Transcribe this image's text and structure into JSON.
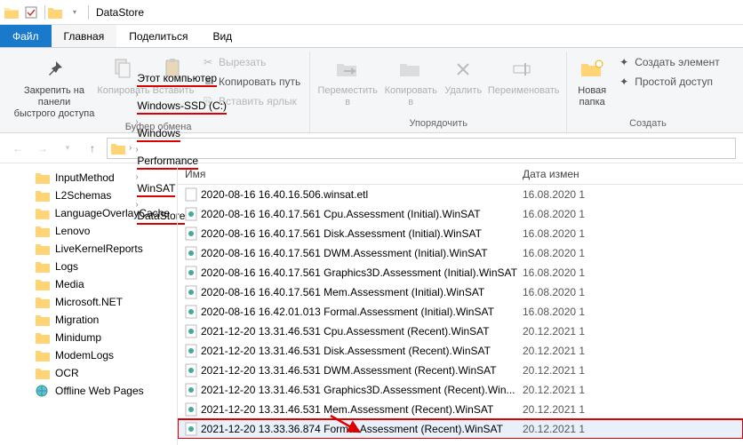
{
  "window": {
    "title": "DataStore"
  },
  "menu": {
    "file": "Файл",
    "home": "Главная",
    "share": "Поделиться",
    "view": "Вид"
  },
  "ribbon": {
    "pin": "Закрепить на панели\nбыстрого доступа",
    "copy": "Копировать",
    "paste": "Вставить",
    "cut": "Вырезать",
    "copypath": "Копировать путь",
    "pastelink": "Вставить ярлык",
    "group_clip": "Буфер обмена",
    "moveto": "Переместить\nв",
    "copyto": "Копировать\nв",
    "delete": "Удалить",
    "rename": "Переименовать",
    "group_org": "Упорядочить",
    "newfolder": "Новая\nпапка",
    "newitem": "Создать элемент",
    "easyaccess": "Простой доступ",
    "group_new": "Создать"
  },
  "breadcrumb": [
    "Этот компьютер",
    "Windows-SSD (C:)",
    "Windows",
    "Performance",
    "WinSAT",
    "DataStore"
  ],
  "columns": {
    "name": "Имя",
    "date": "Дата измен"
  },
  "tree": [
    {
      "label": "InputMethod",
      "icon": "folder"
    },
    {
      "label": "L2Schemas",
      "icon": "folder"
    },
    {
      "label": "LanguageOverlayCache",
      "icon": "folder"
    },
    {
      "label": "Lenovo",
      "icon": "folder"
    },
    {
      "label": "LiveKernelReports",
      "icon": "folder"
    },
    {
      "label": "Logs",
      "icon": "folder"
    },
    {
      "label": "Media",
      "icon": "folder"
    },
    {
      "label": "Microsoft.NET",
      "icon": "folder"
    },
    {
      "label": "Migration",
      "icon": "folder"
    },
    {
      "label": "Minidump",
      "icon": "folder"
    },
    {
      "label": "ModemLogs",
      "icon": "folder"
    },
    {
      "label": "OCR",
      "icon": "folder"
    },
    {
      "label": "Offline Web Pages",
      "icon": "web"
    }
  ],
  "files": [
    {
      "name": "2020-08-16 16.40.16.506.winsat.etl",
      "date": "16.08.2020 1",
      "icon": "etl"
    },
    {
      "name": "2020-08-16 16.40.17.561 Cpu.Assessment (Initial).WinSAT",
      "date": "16.08.2020 1",
      "icon": "winsat"
    },
    {
      "name": "2020-08-16 16.40.17.561 Disk.Assessment (Initial).WinSAT",
      "date": "16.08.2020 1",
      "icon": "winsat"
    },
    {
      "name": "2020-08-16 16.40.17.561 DWM.Assessment (Initial).WinSAT",
      "date": "16.08.2020 1",
      "icon": "winsat"
    },
    {
      "name": "2020-08-16 16.40.17.561 Graphics3D.Assessment (Initial).WinSAT",
      "date": "16.08.2020 1",
      "icon": "winsat"
    },
    {
      "name": "2020-08-16 16.40.17.561 Mem.Assessment (Initial).WinSAT",
      "date": "16.08.2020 1",
      "icon": "winsat"
    },
    {
      "name": "2020-08-16 16.42.01.013 Formal.Assessment (Initial).WinSAT",
      "date": "16.08.2020 1",
      "icon": "winsat"
    },
    {
      "name": "2021-12-20 13.31.46.531 Cpu.Assessment (Recent).WinSAT",
      "date": "20.12.2021 1",
      "icon": "winsat"
    },
    {
      "name": "2021-12-20 13.31.46.531 Disk.Assessment (Recent).WinSAT",
      "date": "20.12.2021 1",
      "icon": "winsat"
    },
    {
      "name": "2021-12-20 13.31.46.531 DWM.Assessment (Recent).WinSAT",
      "date": "20.12.2021 1",
      "icon": "winsat"
    },
    {
      "name": "2021-12-20 13.31.46.531 Graphics3D.Assessment (Recent).Win...",
      "date": "20.12.2021 1",
      "icon": "winsat"
    },
    {
      "name": "2021-12-20 13.31.46.531 Mem.Assessment (Recent).WinSAT",
      "date": "20.12.2021 1",
      "icon": "winsat"
    },
    {
      "name": "2021-12-20 13.33.36.874 Formal.Assessment (Recent).WinSAT",
      "date": "20.12.2021 1",
      "icon": "winsat",
      "hl": true
    }
  ]
}
